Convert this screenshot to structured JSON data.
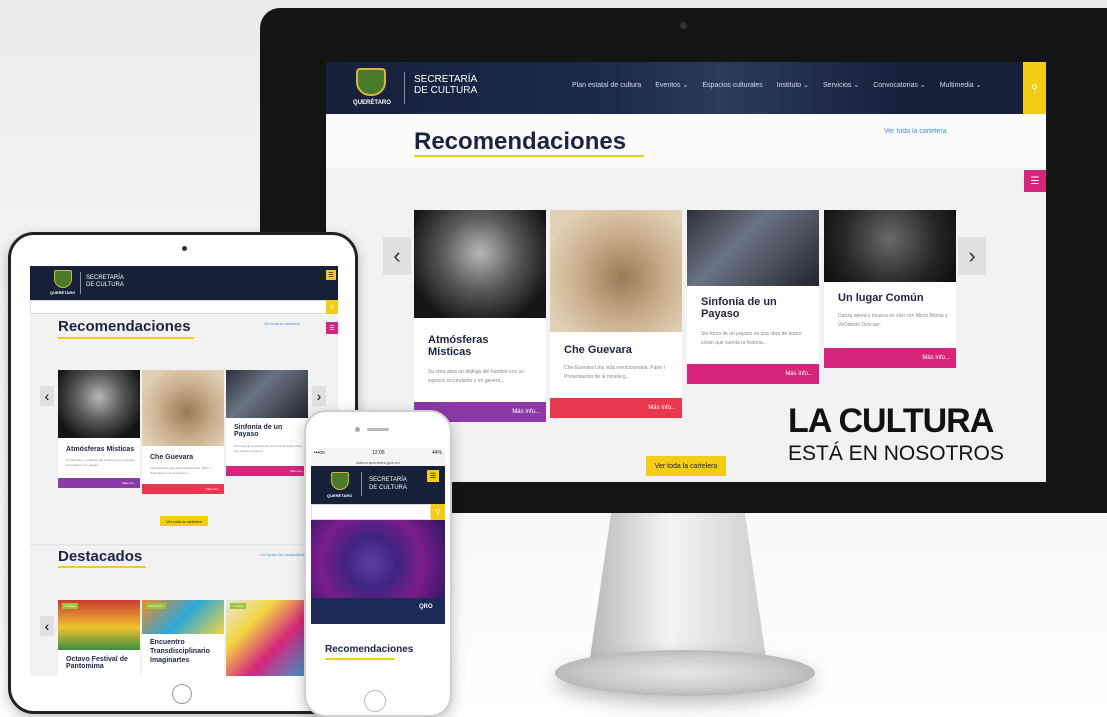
{
  "desktop": {
    "logo_text": "QUERÉTARO",
    "brand_lines": [
      "SECRETARÍA",
      "DE CULTURA"
    ],
    "nav": [
      "Plan estatal de cultura",
      "Eventos ⌄",
      "Espacios culturales",
      "Instituto ⌄",
      "Servicios ⌄",
      "Convocatorias ⌄",
      "Multimedia ⌄"
    ],
    "section_title": "Recomendaciones",
    "see_all": "Ver toda la cartelera",
    "button": "Ver toda la cartelera",
    "more_label": "Más info...",
    "cards": [
      {
        "title": "Atmósferas Místicas",
        "desc": "Su obra abre un diálogo del hombre con su espacio circundante y en genera...",
        "foot_color": "#8b3aa7"
      },
      {
        "title": "Che Guevara",
        "desc": "Che Guevara Una vida revolucionaria. Parte I Presentación de la novela g...",
        "foot_color": "#e8384f"
      },
      {
        "title": "Sinfonía de un Payaso",
        "desc": "Sin-fonía de un payaso es una obra de teatro clown que cuenta la historia...",
        "foot_color": "#d6267b"
      },
      {
        "title": "Un lugar Común",
        "desc": "Danza aérea y música en vivo con Micro Ritmia y VeOdonio Descuer.",
        "foot_color": "#d6267b"
      }
    ],
    "slogan": [
      "LA CULTURA",
      "ESTÁ EN NOSOTROS"
    ]
  },
  "tablet": {
    "brand_lines": [
      "SECRETARÍA",
      "DE CULTURA"
    ],
    "logo_text": "QUERÉTARO",
    "section_title": "Recomendaciones",
    "see_all": "Ver toda la cartelera",
    "button": "Ver toda la cartelera",
    "more_label": "Más info...",
    "cards": [
      {
        "title": "Atmósferas Místicas",
        "desc": "Su obra abre un diálogo del hombre con su espacio circundante y en genera..."
      },
      {
        "title": "Che Guevara",
        "desc": "Che Guevara Una vida revolucionaria. Parte I Presentación de la novela g..."
      },
      {
        "title": "Sinfonía de un Payaso",
        "desc": "Sin-fonía de un payaso es una obra de teatro clown que cuenta la historia..."
      }
    ],
    "section2_title": "Destacados",
    "section2_see_all": "Ver todos los destacados",
    "featured": [
      {
        "title": "Octavo Festival de Pantomima",
        "tag": "Festival"
      },
      {
        "title": "Encuentro Transdisciplinario Imaginartes",
        "tag": "Encuentro"
      },
      {
        "title": "",
        "tag": "Festival"
      }
    ]
  },
  "phone": {
    "status_left": "•••oo",
    "status_time": "12:05",
    "status_right": "44%",
    "url": "cultura.queretaro.gob.mx",
    "brand_lines": [
      "SECRETARÍA",
      "DE CULTURA"
    ],
    "logo_text": "QUERÉTARO",
    "hero_badge": "QRO",
    "section_title": "Recomendaciones"
  },
  "colors": {
    "navy": "#172039",
    "yellow": "#f2cc15",
    "magenta": "#d6267b",
    "purple": "#8b3aa7",
    "red": "#e8384f"
  }
}
